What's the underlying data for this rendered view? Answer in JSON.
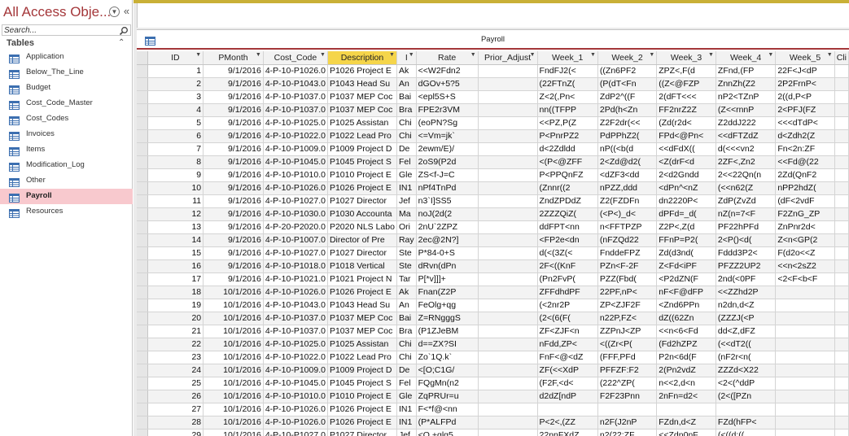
{
  "nav": {
    "title": "All Access Obje...",
    "search_placeholder": "Search...",
    "group_label": "Tables",
    "items": [
      {
        "label": "Application",
        "active": false
      },
      {
        "label": "Below_The_Line",
        "active": false
      },
      {
        "label": "Budget",
        "active": false
      },
      {
        "label": "Cost_Code_Master",
        "active": false
      },
      {
        "label": "Cost_Codes",
        "active": false
      },
      {
        "label": "Invoices",
        "active": false
      },
      {
        "label": "Items",
        "active": false
      },
      {
        "label": "Modification_Log",
        "active": false
      },
      {
        "label": "Other",
        "active": false
      },
      {
        "label": "Payroll",
        "active": true
      },
      {
        "label": "Resources",
        "active": false
      }
    ]
  },
  "tab": {
    "title": "Payroll"
  },
  "colors": {
    "accent": "#a4373a",
    "highlight_header": "#f5d54a",
    "active_nav": "#f8c9ce"
  },
  "datasheet": {
    "columns": [
      "ID",
      "PMonth",
      "Cost_Code",
      "Description",
      "I",
      "Rate",
      "Prior_Adjust",
      "Week_1",
      "Week_2",
      "Week_3",
      "Week_4",
      "Week_5",
      "Cli"
    ],
    "rows": [
      [
        "1",
        "9/1/2016",
        "4-P-10-P1026.0",
        "P1026 Project E",
        "Ak",
        "<<W2Fdn2",
        "",
        "FndFJ2(<",
        "((Zn6PF2",
        "ZPZ<,F(d",
        "ZFnd,(FP",
        "22F<J<dP",
        ""
      ],
      [
        "2",
        "9/1/2016",
        "4-P-10-P1043.0",
        "P1043 Head Su",
        "An",
        "dGOv+5?5",
        "",
        "(22FTnZ(",
        "(P(dT<Fn",
        "((Z<@FZP",
        "ZnnZh(Z2",
        "2P2FrnP<",
        ""
      ],
      [
        "3",
        "9/1/2016",
        "4-P-10-P1037.0",
        "P1037 MEP Coc",
        "Bai",
        "<epl5S+S",
        "",
        "Z<2(,Pn<",
        "ZdP2^((F",
        "2(dFT<<<",
        "nP2<TZnP",
        "2((d,P<P",
        ""
      ],
      [
        "4",
        "9/1/2016",
        "4-P-10-P1037.0",
        "P1037 MEP Coc",
        "Bra",
        "FPE2r3VM",
        "",
        "nn((TFPP",
        "2Pd(h<Zn",
        "FF2nrZ2Z",
        "(Z<<rnnP",
        "2<PFJ(FZ",
        ""
      ],
      [
        "5",
        "9/1/2016",
        "4-P-10-P1025.0",
        "P1025 Assistan",
        "Chi",
        "(eoPN?Sg",
        "",
        "<<PZ,P(Z",
        "Z2F2dr(<<",
        "(Zd(r2d<",
        "Z2ddJ222",
        "<<<dTdP<",
        ""
      ],
      [
        "6",
        "9/1/2016",
        "4-P-10-P1022.0",
        "P1022 Lead Pro",
        "Chi",
        "<=Vm=jk`",
        "",
        "P<PnrPZ2",
        "PdPPhZ2(",
        "FPd<@Pn<",
        "<<dFTZdZ",
        "d<Zdh2(Z",
        ""
      ],
      [
        "7",
        "9/1/2016",
        "4-P-10-P1009.0",
        "P1009 Project D",
        "De",
        "2ewm/E)/",
        "",
        "d<2Zdldd",
        "nP((<b(d",
        "<<dFdX((",
        "d(<<<vn2",
        "Fn<2n:ZF",
        ""
      ],
      [
        "8",
        "9/1/2016",
        "4-P-10-P1045.0",
        "P1045 Project S",
        "Fel",
        "2oS9(P2d",
        "",
        "<(P<@ZFF",
        "2<Zd@d2(",
        "<Z(drF<d",
        "2ZF<,Zn2",
        "<<Fd@(22",
        ""
      ],
      [
        "9",
        "9/1/2016",
        "4-P-10-P1010.0",
        "P1010 Project E",
        "Gle",
        "ZS<f-J=C",
        "",
        "P<PPQnFZ",
        "<dZF3<dd",
        "2<d2Gndd",
        "2<<22Qn(n",
        "2Zd(QnF2",
        ""
      ],
      [
        "10",
        "9/1/2016",
        "4-P-10-P1026.0",
        "P1026 Project E",
        "IN1",
        "nPf4TnPd",
        "",
        "(Znnr((2",
        "nPZZ,ddd",
        "<dPn^<nZ",
        "(<<n62(Z",
        "nPP2hdZ(",
        ""
      ],
      [
        "11",
        "9/1/2016",
        "4-P-10-P1027.0",
        "P1027 Director",
        "Jef",
        "n3`I]SS5",
        "",
        "ZndZPDdZ",
        "Z2(FZDFn",
        "dn2220P<",
        "ZdP(ZvZd",
        "(dF<2vdF",
        ""
      ],
      [
        "12",
        "9/1/2016",
        "4-P-10-P1030.0",
        "P1030 Accounta",
        "Ma",
        "noJ(2d(2",
        "",
        "2ZZZQiZ(",
        "(<P<)_d<",
        "dPFd=_d(",
        "nZ(n=7<F",
        "F2ZnG_ZP",
        ""
      ],
      [
        "13",
        "9/1/2016",
        "4-P-20-P2020.0",
        "P2020 NLS Labo",
        "Ori",
        "2nU`2ZPZ",
        "",
        "ddFPT<nn",
        "n<FFTPZP",
        "Z2P<,Z(d",
        "PF22hPFd",
        "ZnPnr2d<",
        ""
      ],
      [
        "14",
        "9/1/2016",
        "4-P-10-P1007.0",
        "Director of Pre",
        "Ray",
        "2ec@2N?]",
        "",
        "<FP2e<dn",
        "(nFZQd22",
        "FFnP=P2(",
        "2<P()<d(",
        "Z<n<GP(2",
        ""
      ],
      [
        "15",
        "9/1/2016",
        "4-P-10-P1027.0",
        "P1027 Director",
        "Ste",
        "P*84-0+S",
        "",
        "d(<(3Z(<",
        "FnddeFPZ",
        "Zd(d3nd(",
        "Fddd3P2<",
        "F(d2o<<Z",
        ""
      ],
      [
        "16",
        "9/1/2016",
        "4-P-10-P1018.0",
        "P1018 Vertical",
        "Ste",
        "dRvn(dPn",
        "",
        "2F<((KnF",
        "PZn<F-2F",
        "Z<Fd<iPF",
        "PFZZ2UP2",
        "<<n<2sZ2",
        ""
      ],
      [
        "17",
        "9/1/2016",
        "4-P-10-P1021.0",
        "P1021 Project N",
        "Tar",
        "P[*v]]]+",
        "",
        "(Pn2FvP(",
        "PZZ(Fbd(",
        "<P2dZN(F",
        "2nd(<0PF",
        "<2<F<b<F",
        ""
      ],
      [
        "18",
        "10/1/2016",
        "4-P-10-P1026.0",
        "P1026 Project E",
        "Ak",
        "Fnan(Z2P",
        "",
        "ZFFdhdPF",
        "22PF,nP<",
        "nF<F@dFP",
        "<<ZZhd2P",
        "",
        ""
      ],
      [
        "19",
        "10/1/2016",
        "4-P-10-P1043.0",
        "P1043 Head Su",
        "An",
        "FeOlg+qg",
        "",
        "(<2nr2P",
        "ZP<ZJF2F",
        "<Znd6PPn",
        "n2dn,d<Z",
        "",
        ""
      ],
      [
        "20",
        "10/1/2016",
        "4-P-10-P1037.0",
        "P1037 MEP Coc",
        "Bai",
        "Z=RNgggS",
        "",
        "(2<(6(F(",
        "n22P,FZ<",
        "dZ((62Zn",
        "(ZZZJ(<P",
        "",
        ""
      ],
      [
        "21",
        "10/1/2016",
        "4-P-10-P1037.0",
        "P1037 MEP Coc",
        "Bra",
        "(P1ZJeBM",
        "",
        "ZF<ZJF<n",
        "ZZPnJ<ZP",
        "<<n<6<Fd",
        "dd<Z,dFZ",
        "",
        ""
      ],
      [
        "22",
        "10/1/2016",
        "4-P-10-P1025.0",
        "P1025 Assistan",
        "Chi",
        "d==ZX?SI",
        "",
        "nFdd,ZP<",
        "<((Zr<P(",
        "(Fd2hZPZ",
        "(<<dT2((",
        "",
        ""
      ],
      [
        "23",
        "10/1/2016",
        "4-P-10-P1022.0",
        "P1022 Lead Pro",
        "Chi",
        "Zo`1Q.k`",
        "",
        "FnF<@<dZ",
        "(FFF,PFd",
        "P2n<6d(F",
        "(nF2r<n(",
        "",
        ""
      ],
      [
        "24",
        "10/1/2016",
        "4-P-10-P1009.0",
        "P1009 Project D",
        "De",
        "<[O;C1G/",
        "",
        "ZF(<<XdP",
        "PFFZF:F2",
        "2(Pn2vdZ",
        "ZZZd<X22",
        "",
        ""
      ],
      [
        "25",
        "10/1/2016",
        "4-P-10-P1045.0",
        "P1045 Project S",
        "Fel",
        "FQgMn(n2",
        "",
        "(F2F,<d<",
        "(222^ZP(",
        "n<<2,d<n",
        "<2<(^ddP",
        "",
        ""
      ],
      [
        "26",
        "10/1/2016",
        "4-P-10-P1010.0",
        "P1010 Project E",
        "Gle",
        "ZqPRUr=u",
        "",
        "d2dZ[ndP",
        "F2F23Pnn",
        "2nFn=d2<",
        "(2<([PZn",
        "",
        ""
      ],
      [
        "27",
        "10/1/2016",
        "4-P-10-P1026.0",
        "P1026 Project E",
        "IN1",
        "F<*f@<nn",
        "",
        "",
        "",
        "",
        "",
        "",
        ""
      ],
      [
        "28",
        "10/1/2016",
        "4-P-10-P1026.0",
        "P1026 Project E",
        "IN1",
        "(P*ALFPd",
        "",
        "P<2<,(ZZ",
        "n2F(J2nP",
        "FZdn,d<Z",
        "FZd(hFP<",
        "",
        ""
      ],
      [
        "29",
        "10/1/2016",
        "4-P-10-P1027.0",
        "P1027 Director",
        "Jef",
        "<Q,+glg5",
        "",
        "22nnFXdZ",
        "n2(22:ZF",
        "<<Zdn0nF",
        "(<((d:((",
        "",
        ""
      ]
    ]
  }
}
